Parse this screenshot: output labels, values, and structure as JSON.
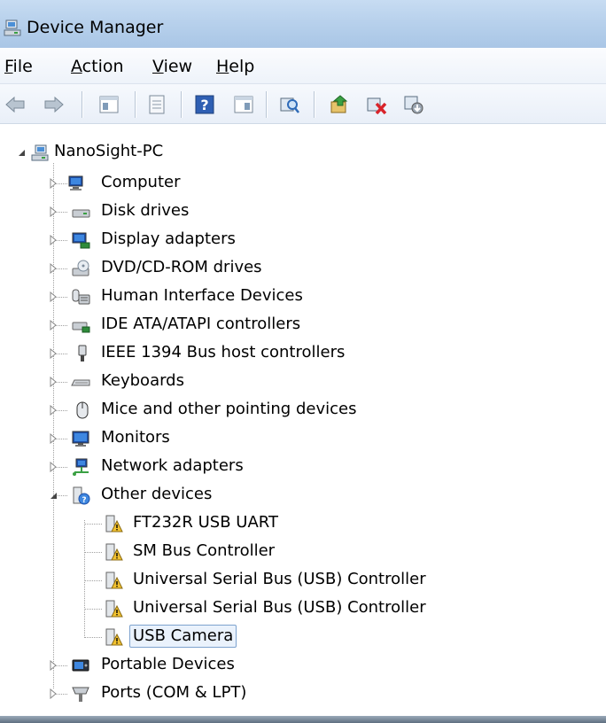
{
  "window": {
    "title": "Device Manager"
  },
  "menu": [
    {
      "key": "file",
      "label_ul": "F",
      "label_rest": "ile"
    },
    {
      "key": "action",
      "label_ul": "A",
      "label_rest": "ction"
    },
    {
      "key": "view",
      "label_ul": "V",
      "label_rest": "iew"
    },
    {
      "key": "help",
      "label_ul": "H",
      "label_rest": "elp"
    }
  ],
  "toolbar": {
    "buttons": [
      "back-arrow-icon",
      "forward-arrow-icon",
      "show-hide-tree-icon",
      "properties-icon",
      "help-icon",
      "action-pane-icon",
      "scan-hardware-icon",
      "update-driver-icon",
      "uninstall-icon",
      "disable-device-icon"
    ]
  },
  "tree": {
    "root": {
      "label": "NanoSight-PC",
      "icon": "computer-network-icon",
      "expanded": true
    },
    "categories": [
      {
        "label": "Computer",
        "icon": "computer-icon",
        "expanded": false
      },
      {
        "label": "Disk drives",
        "icon": "disk-drive-icon",
        "expanded": false
      },
      {
        "label": "Display adapters",
        "icon": "display-adapter-icon",
        "expanded": false
      },
      {
        "label": "DVD/CD-ROM drives",
        "icon": "dvd-drive-icon",
        "expanded": false
      },
      {
        "label": "Human Interface Devices",
        "icon": "hid-icon",
        "expanded": false
      },
      {
        "label": "IDE ATA/ATAPI controllers",
        "icon": "ide-controller-icon",
        "expanded": false
      },
      {
        "label": "IEEE 1394 Bus host controllers",
        "icon": "firewire-icon",
        "expanded": false
      },
      {
        "label": "Keyboards",
        "icon": "keyboard-icon",
        "expanded": false
      },
      {
        "label": "Mice and other pointing devices",
        "icon": "mouse-icon",
        "expanded": false
      },
      {
        "label": "Monitors",
        "icon": "monitor-icon",
        "expanded": false
      },
      {
        "label": "Network adapters",
        "icon": "network-adapter-icon",
        "expanded": false
      },
      {
        "label": "Other devices",
        "icon": "unknown-device-icon",
        "expanded": true,
        "children": [
          {
            "label": "FT232R USB UART",
            "icon": "warning-device-icon",
            "selected": false
          },
          {
            "label": "SM Bus Controller",
            "icon": "warning-device-icon",
            "selected": false
          },
          {
            "label": "Universal Serial Bus (USB) Controller",
            "icon": "warning-device-icon",
            "selected": false
          },
          {
            "label": "Universal Serial Bus (USB) Controller",
            "icon": "warning-device-icon",
            "selected": false
          },
          {
            "label": "USB Camera",
            "icon": "warning-device-icon",
            "selected": true
          }
        ]
      },
      {
        "label": "Portable Devices",
        "icon": "portable-device-icon",
        "expanded": false
      },
      {
        "label": "Ports (COM & LPT)",
        "icon": "port-icon",
        "expanded": false
      }
    ]
  },
  "colors": {
    "title_bar": "#b8d1ec",
    "selection_border": "#7da2ce",
    "selection_fill": "#eaf2fc",
    "warning": "#f2c230"
  }
}
